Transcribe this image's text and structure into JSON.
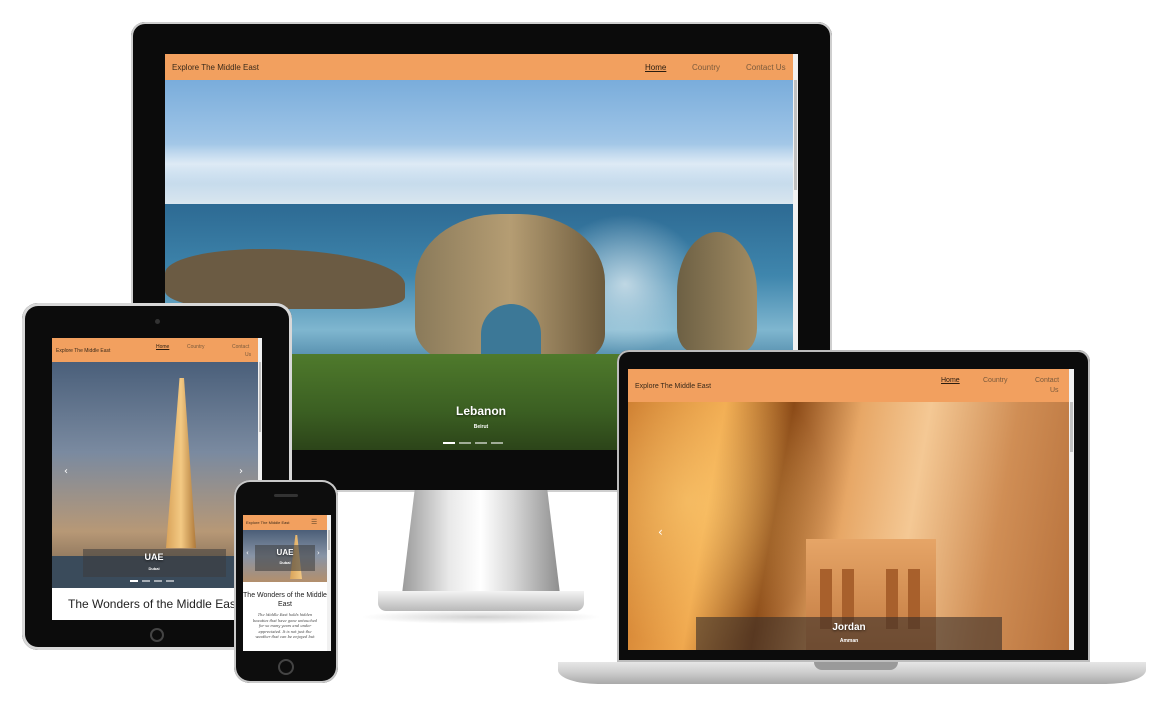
{
  "desktop": {
    "brand": "Explore The Middle East",
    "nav": [
      "Home",
      "Country",
      "Contact Us"
    ],
    "slide_title": "Lebanon",
    "slide_subtitle": "Beirut"
  },
  "tablet": {
    "brand": "Explore The Middle East",
    "nav": [
      "Home",
      "Country",
      "Contact",
      "Us"
    ],
    "slide_title": "UAE",
    "slide_subtitle": "Dubai",
    "heading": "The Wonders of the Middle East",
    "prev_icon": "‹",
    "next_icon": "›"
  },
  "phone": {
    "brand": "Explore The Middle East",
    "menu_icon": "☰",
    "slide_title": "UAE",
    "slide_subtitle": "Dubai",
    "heading": "The Wonders of the Middle East",
    "body_lines": [
      "The Middle East holds hidden",
      "beauties that have gone untouched",
      "for so many years and under",
      "appreciated. It is not just the",
      "weather that can be enjoyed but"
    ],
    "prev_icon": "‹",
    "next_icon": "›"
  },
  "laptop": {
    "brand": "Explore The Middle East",
    "nav": [
      "Home",
      "Country",
      "Contact",
      "Us"
    ],
    "slide_title": "Jordan",
    "slide_subtitle": "Amman",
    "prev_icon": "‹"
  },
  "colors": {
    "nav_bg": "#f2a05f",
    "accent_text": "#2b1d10"
  }
}
